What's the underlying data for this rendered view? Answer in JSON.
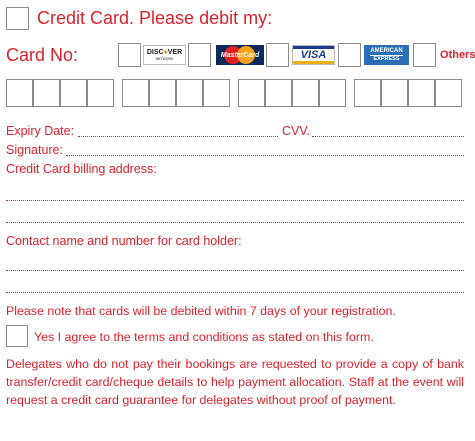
{
  "header": {
    "title": "Credit Card. Please debit my:"
  },
  "card_row": {
    "label": "Card No:",
    "cards": [
      {
        "name": "discover",
        "text_a": "DISC",
        "text_b": "VER",
        "sub": "NETWORK"
      },
      {
        "name": "mastercard",
        "text": "MasterCard"
      },
      {
        "name": "visa",
        "text": "VISA"
      },
      {
        "name": "amex",
        "text_a": "AMERICAN",
        "text_b": "EXPRESS"
      }
    ],
    "others_label": "Others"
  },
  "fields": {
    "expiry_label": "Expiry Date:",
    "cvv_label": "CVV.",
    "signature_label": "Signature:",
    "billing_label": "Credit Card billing address:",
    "contact_label": "Contact name and number for card holder:"
  },
  "notes": {
    "debit_notice": "Please note that cards will be debited within 7 days of your registration.",
    "agree_label": "Yes I agree to the terms and conditions as stated on this form.",
    "paragraph": "Delegates who do not pay their bookings are requested to provide a copy of bank transfer/credit card/cheque details to help payment allocation. Staff at the event will request a credit card guarantee for delegates without proof of payment."
  },
  "colors": {
    "accent": "#d9232d",
    "box_border": "#8c8c8c"
  }
}
